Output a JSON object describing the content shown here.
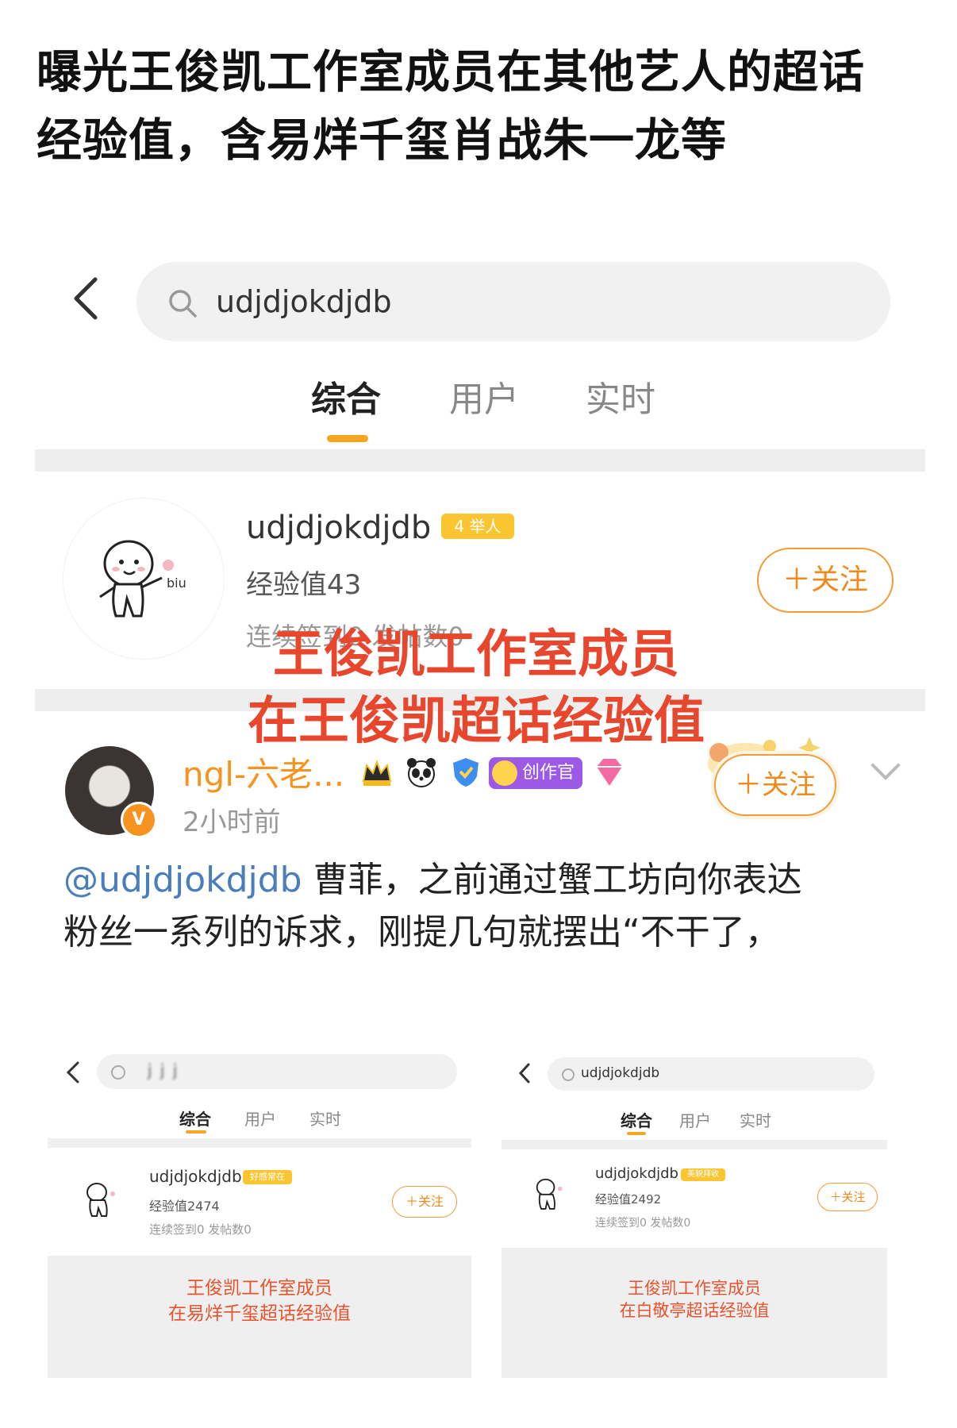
{
  "headline": {
    "line1": "曝光王俊凯工作室成员在其他艺人的超话",
    "line2": "经验值，含易烊千玺肖战朱一龙等"
  },
  "main": {
    "search": {
      "value": "udjdjokdjdb"
    },
    "tabs": [
      "综合",
      "用户",
      "实时"
    ],
    "user": {
      "name": "udjdjokdjdb",
      "badge": "4 举人",
      "exp": "经验值43",
      "stats": "连续签到0 发帖数0",
      "follow": "＋关注"
    },
    "overlay": {
      "line1": "王俊凯工作室成员",
      "line2": "在王俊凯超话经验值"
    },
    "post": {
      "name": "ngl-六老...",
      "badge_creator": "创作官",
      "time": "2小时前",
      "follow": "＋关注",
      "mention": "@udjdjokdjdb",
      "text_line1": " 曹菲，之前通过蟹工坊向你表达",
      "text_line2": "粉丝一系列的诉求，刚提几句就摆出“不干了，"
    }
  },
  "left_mini": {
    "search": "j j j",
    "tabs": [
      "综合",
      "用户",
      "实时"
    ],
    "name": "udjdjokdjdb",
    "badge": "好感常在",
    "exp": "经验值2474",
    "stats": "连续签到0 发帖数0",
    "follow": "＋关注",
    "caption1": "王俊凯工作室成员",
    "caption2": "在易烊千玺超话经验值"
  },
  "right_mini": {
    "search": "udjdjokdjdb",
    "tabs": [
      "综合",
      "用户",
      "实时"
    ],
    "name": "udjdjokdjdb",
    "badge": "美貌拜收",
    "exp": "经验值2492",
    "stats": "连续签到0 发帖数0",
    "follow": "＋关注",
    "caption1": "王俊凯工作室成员",
    "caption2": "在白敬亭超话经验值"
  },
  "colors": {
    "accent": "#f7a71f",
    "overlay_red": "#e8472d",
    "link": "#4a7ebb"
  }
}
